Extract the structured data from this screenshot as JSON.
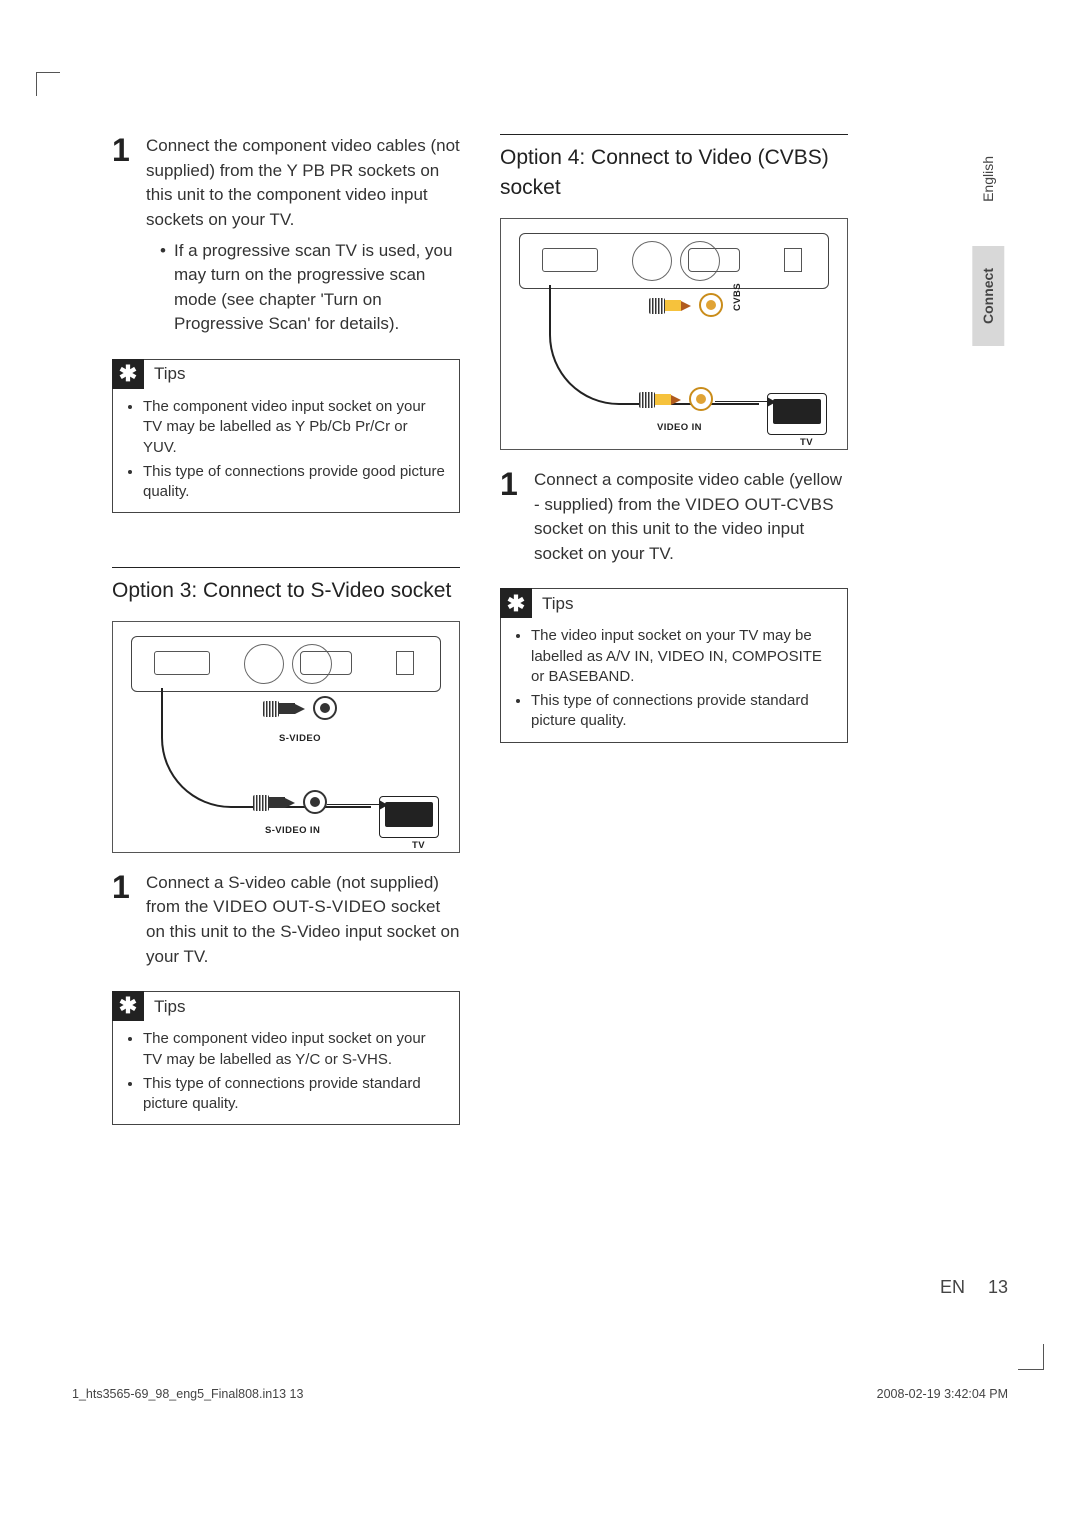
{
  "sideTabs": {
    "lang": "English",
    "chapter": "Connect"
  },
  "left": {
    "step1": {
      "num": "1",
      "body": "Connect the component video cables (not supplied) from the Y PB PR sockets on this unit to the component video input sockets on your TV.",
      "sub": "If a progressive scan TV is used, you may turn on the progressive scan mode (see chapter 'Turn on Progressive Scan' for details)."
    },
    "tips1": {
      "title": "Tips",
      "items": [
        "The component video input socket on your TV may be labelled as Y Pb/Cb Pr/Cr or YUV.",
        "This type of connections provide good picture quality."
      ]
    },
    "option3": {
      "title": "Option 3: Connect to S-Video socket",
      "labels": {
        "svideo": "S-VIDEO",
        "svideo_in": "S-VIDEO IN",
        "tv": "TV"
      },
      "step": {
        "num": "1",
        "body_pre": "Connect a S-video cable (not supplied) from the ",
        "body_strong": "VIDEO OUT-S-VIDEO",
        "body_post": " socket on this unit to the S-Video input socket on your TV."
      },
      "tips": {
        "title": "Tips",
        "items": [
          "The component video input socket on your TV may be labelled as Y/C or S-VHS.",
          "This type of connections provide standard picture quality."
        ]
      }
    }
  },
  "right": {
    "option4": {
      "title": "Option 4: Connect to Video (CVBS) socket",
      "labels": {
        "cvbs": "CVBS",
        "video_in": "VIDEO IN",
        "tv": "TV"
      },
      "step": {
        "num": "1",
        "body_pre": "Connect a composite video cable (yellow - supplied) from the ",
        "body_strong": "VIDEO OUT-CVBS",
        "body_post": " socket on this unit to the video input socket on your TV."
      },
      "tips": {
        "title": "Tips",
        "items": [
          "The video input socket on your TV may be labelled as A/V IN, VIDEO IN, COMPOSITE or BASEBAND.",
          "This type of connections provide standard picture quality."
        ]
      }
    }
  },
  "footer": {
    "lang": "EN",
    "page": "13"
  },
  "printmeta": {
    "file": "1_hts3565-69_98_eng5_Final808.in13   13",
    "ts": "2008-02-19   3:42:04 PM"
  }
}
